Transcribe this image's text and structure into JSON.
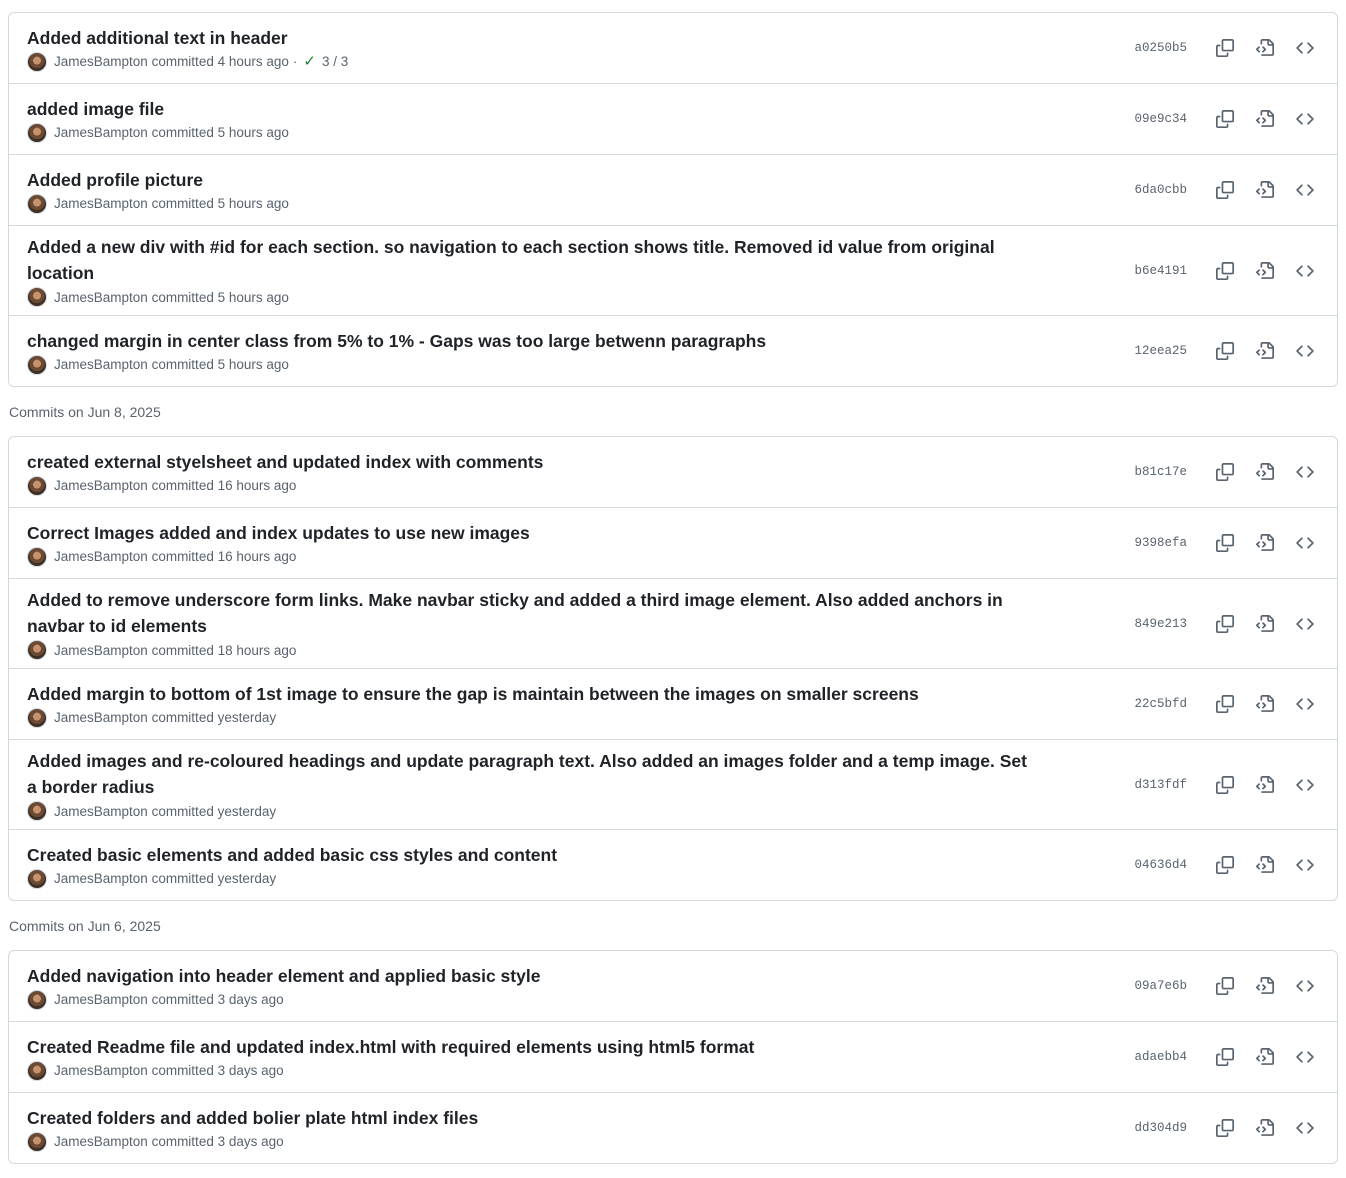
{
  "groups": [
    {
      "header": "",
      "commits": [
        {
          "title": "Added additional text in header",
          "author": "JamesBampton",
          "verb": "committed",
          "time": "4 hours ago",
          "checks": "3 / 3",
          "sha": "a0250b5"
        },
        {
          "title": "added image file",
          "author": "JamesBampton",
          "verb": "committed",
          "time": "5 hours ago",
          "sha": "09e9c34"
        },
        {
          "title": "Added profile picture",
          "author": "JamesBampton",
          "verb": "committed",
          "time": "5 hours ago",
          "sha": "6da0cbb"
        },
        {
          "title": "Added a new div with #id for each section. so navigation to each section shows title. Removed id value from original location",
          "author": "JamesBampton",
          "verb": "committed",
          "time": "5 hours ago",
          "sha": "b6e4191"
        },
        {
          "title": "changed margin in center class from 5% to 1% - Gaps was too large betwenn paragraphs",
          "author": "JamesBampton",
          "verb": "committed",
          "time": "5 hours ago",
          "sha": "12eea25"
        }
      ]
    },
    {
      "header": "Commits on Jun 8, 2025",
      "commits": [
        {
          "title": "created external styelsheet and updated index with comments",
          "author": "JamesBampton",
          "verb": "committed",
          "time": "16 hours ago",
          "sha": "b81c17e"
        },
        {
          "title": "Correct Images added and index updates to use new images",
          "author": "JamesBampton",
          "verb": "committed",
          "time": "16 hours ago",
          "sha": "9398efa"
        },
        {
          "title": "Added to remove underscore form links. Make navbar sticky and added a third image element. Also added anchors in navbar to id elements",
          "author": "JamesBampton",
          "verb": "committed",
          "time": "18 hours ago",
          "sha": "849e213"
        },
        {
          "title": "Added margin to bottom of 1st image to ensure the gap is maintain between the images on smaller screens",
          "author": "JamesBampton",
          "verb": "committed",
          "time": "yesterday",
          "sha": "22c5bfd"
        },
        {
          "title": "Added images and re-coloured headings and update paragraph text. Also added an images folder and a temp image. Set a border radius",
          "author": "JamesBampton",
          "verb": "committed",
          "time": "yesterday",
          "sha": "d313fdf"
        },
        {
          "title": "Created basic elements and added basic css styles and content",
          "author": "JamesBampton",
          "verb": "committed",
          "time": "yesterday",
          "sha": "04636d4"
        }
      ]
    },
    {
      "header": "Commits on Jun 6, 2025",
      "commits": [
        {
          "title": "Added navigation into header element and applied basic style",
          "author": "JamesBampton",
          "verb": "committed",
          "time": "3 days ago",
          "sha": "09a7e6b"
        },
        {
          "title": "Created Readme file and updated index.html with required elements using html5 format",
          "author": "JamesBampton",
          "verb": "committed",
          "time": "3 days ago",
          "sha": "adaebb4"
        },
        {
          "title": "Created folders and added bolier plate html index files",
          "author": "JamesBampton",
          "verb": "committed",
          "time": "3 days ago",
          "sha": "dd304d9"
        }
      ]
    }
  ],
  "icons": {
    "copy": "copy-icon",
    "browse": "file-code-icon",
    "code": "code-icon",
    "check": "check-icon"
  },
  "colors": {
    "success": "#1a7f37",
    "border": "#d1d9e0",
    "muted": "#59636e"
  }
}
